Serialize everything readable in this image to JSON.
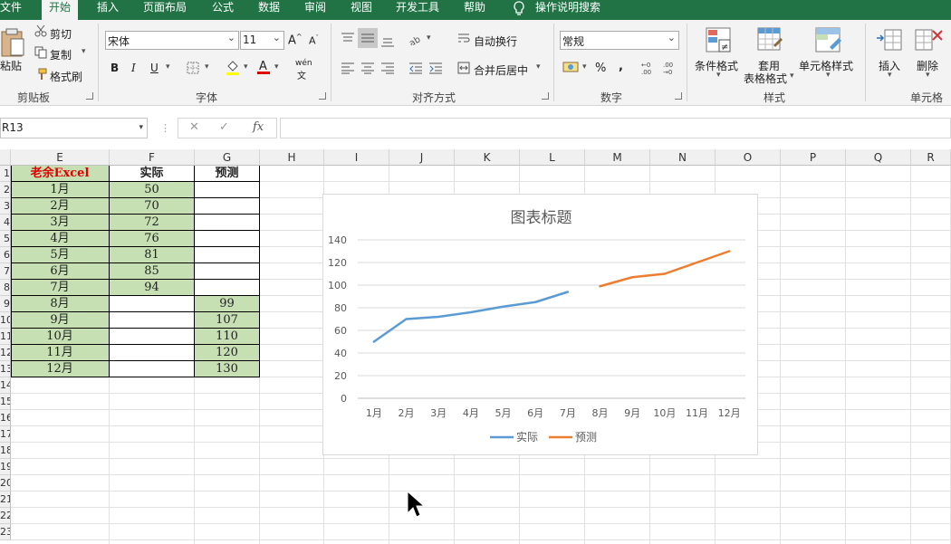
{
  "menu": {
    "items": [
      "文件",
      "开始",
      "插入",
      "页面布局",
      "公式",
      "数据",
      "审阅",
      "视图",
      "开发工具",
      "帮助"
    ],
    "search": "操作说明搜索"
  },
  "ribbon": {
    "clipboard": {
      "paste": "粘贴",
      "cut": "剪切",
      "copy": "复制",
      "format_painter": "格式刷",
      "group": "剪贴板"
    },
    "font": {
      "name": "宋体",
      "size": "11",
      "bold": "B",
      "italic": "I",
      "underline": "U",
      "group": "字体",
      "wen": "wén"
    },
    "alignment": {
      "wrap": "自动换行",
      "merge": "合并后居中",
      "group": "对齐方式"
    },
    "number": {
      "format": "常规",
      "percent": "%",
      "comma": ",",
      "group": "数字"
    },
    "styles": {
      "conditional": "条件格式",
      "table_format_1": "套用",
      "table_format_2": "表格格式",
      "cell_styles": "单元格样式",
      "group": "样式"
    },
    "cells": {
      "insert": "插入",
      "delete": "删除",
      "group": "单元格"
    }
  },
  "formula_bar": {
    "name_box": "R13",
    "fx": "fx",
    "formula": ""
  },
  "columns": [
    "E",
    "F",
    "G",
    "H",
    "I",
    "J",
    "K",
    "L",
    "M",
    "N",
    "O",
    "P",
    "Q",
    "R"
  ],
  "rows": [
    "1",
    "2",
    "3",
    "4",
    "5",
    "6",
    "7",
    "8",
    "9",
    "10",
    "11",
    "12",
    "13",
    "14",
    "15",
    "16",
    "17",
    "18",
    "19",
    "20",
    "21",
    "22",
    "23"
  ],
  "table": {
    "headers": [
      "老余Excel",
      "实际",
      "预测"
    ],
    "rows": [
      [
        "1月",
        "50",
        ""
      ],
      [
        "2月",
        "70",
        ""
      ],
      [
        "3月",
        "72",
        ""
      ],
      [
        "4月",
        "76",
        ""
      ],
      [
        "5月",
        "81",
        ""
      ],
      [
        "6月",
        "85",
        ""
      ],
      [
        "7月",
        "94",
        ""
      ],
      [
        "8月",
        "",
        "99"
      ],
      [
        "9月",
        "",
        "107"
      ],
      [
        "10月",
        "",
        "110"
      ],
      [
        "11月",
        "",
        "120"
      ],
      [
        "12月",
        "",
        "130"
      ]
    ]
  },
  "chart_data": {
    "type": "line",
    "title": "图表标题",
    "categories": [
      "1月",
      "2月",
      "3月",
      "4月",
      "5月",
      "6月",
      "7月",
      "8月",
      "9月",
      "10月",
      "11月",
      "12月"
    ],
    "series": [
      {
        "name": "实际",
        "color": "#5b9bd5",
        "values": [
          50,
          70,
          72,
          76,
          81,
          85,
          94,
          null,
          null,
          null,
          null,
          null
        ]
      },
      {
        "name": "预测",
        "color": "#ed7d31",
        "values": [
          null,
          null,
          null,
          null,
          null,
          null,
          null,
          99,
          107,
          110,
          120,
          130
        ]
      }
    ],
    "ylim": [
      0,
      140
    ],
    "yticks": [
      0,
      20,
      40,
      60,
      80,
      100,
      120,
      140
    ],
    "grid": true,
    "legend": "bottom"
  }
}
